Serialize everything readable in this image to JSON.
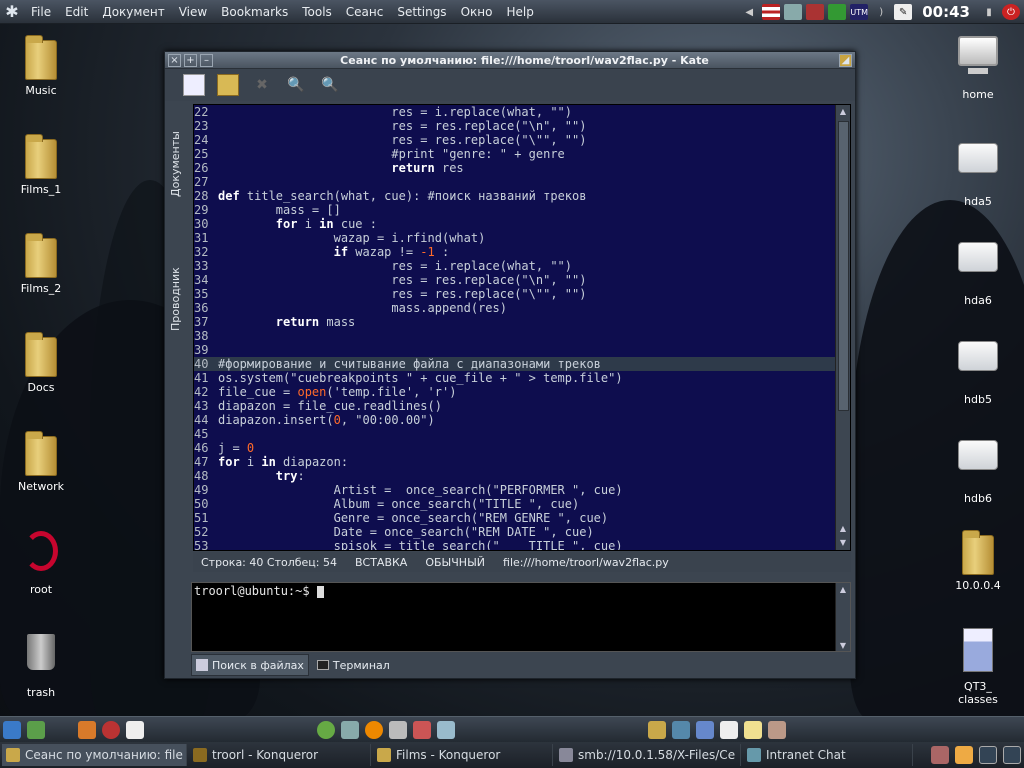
{
  "menubar": {
    "items": [
      "File",
      "Edit",
      "Документ",
      "View",
      "Bookmarks",
      "Tools",
      "Сеанс",
      "Settings",
      "Окно",
      "Help"
    ],
    "clock": "00:43"
  },
  "desktop_left": [
    {
      "label": "Music",
      "icon": "music-folder-icon"
    },
    {
      "label": "Films_1",
      "icon": "films-folder-icon"
    },
    {
      "label": "Films_2",
      "icon": "films-folder-icon"
    },
    {
      "label": "Docs",
      "icon": "docs-folder-icon"
    },
    {
      "label": "Network",
      "icon": "network-folder-icon"
    },
    {
      "label": "root",
      "icon": "debian-swirl-icon"
    },
    {
      "label": "trash",
      "icon": "trash-icon"
    }
  ],
  "desktop_right": [
    {
      "label": "home",
      "icon": "monitor-icon"
    },
    {
      "label": "hda5",
      "icon": "drive-icon"
    },
    {
      "label": "hda6",
      "icon": "drive-icon"
    },
    {
      "label": "hdb5",
      "icon": "drive-icon"
    },
    {
      "label": "hdb6",
      "icon": "drive-icon"
    },
    {
      "label": "10.0.0.4",
      "icon": "network-folder-icon"
    },
    {
      "label": "QT3_\nclasses",
      "icon": "document-icon"
    }
  ],
  "kate": {
    "title": "Сеанс по умолчанию: file:///home/troorl/wav2flac.py - Kate",
    "side_tabs": [
      "Документы",
      "Проводник"
    ],
    "code_lines": [
      [
        "22",
        "\t\t\tres = i.replace(what, \"\")"
      ],
      [
        "23",
        "\t\t\tres = res.replace(\"\\n\", \"\")"
      ],
      [
        "24",
        "\t\t\tres = res.replace(\"\\\"\", \"\")"
      ],
      [
        "25",
        "\t\t\t#print \"genre: \" + genre"
      ],
      [
        "26",
        "\t\t\treturn res"
      ],
      [
        "27",
        ""
      ],
      [
        "28",
        "def title_search(what, cue): #поиск названий треков"
      ],
      [
        "29",
        "\tmass = []"
      ],
      [
        "30",
        "\tfor i in cue :"
      ],
      [
        "31",
        "\t\twazap = i.rfind(what)"
      ],
      [
        "32",
        "\t\tif wazap != -1 :"
      ],
      [
        "33",
        "\t\t\tres = i.replace(what, \"\")"
      ],
      [
        "34",
        "\t\t\tres = res.replace(\"\\n\", \"\")"
      ],
      [
        "35",
        "\t\t\tres = res.replace(\"\\\"\", \"\")"
      ],
      [
        "36",
        "\t\t\tmass.append(res)"
      ],
      [
        "37",
        "\treturn mass"
      ],
      [
        "38",
        ""
      ],
      [
        "39",
        ""
      ],
      [
        "40",
        "#формирование и считывание файла с диапазонами треков"
      ],
      [
        "41",
        "os.system(\"cuebreakpoints \" + cue_file + \" > temp.file\")"
      ],
      [
        "42",
        "file_cue = open('temp.file', 'r')"
      ],
      [
        "43",
        "diapazon = file_cue.readlines()"
      ],
      [
        "44",
        "diapazon.insert(0, \"00:00.00\")"
      ],
      [
        "45",
        ""
      ],
      [
        "46",
        "j = 0"
      ],
      [
        "47",
        "for i in diapazon:"
      ],
      [
        "48",
        "\ttry:"
      ],
      [
        "49",
        "\t\tArtist =  once_search(\"PERFORMER \", cue)"
      ],
      [
        "50",
        "\t\tAlbum = once_search(\"TITLE \", cue)"
      ],
      [
        "51",
        "\t\tGenre = once_search(\"REM GENRE \", cue)"
      ],
      [
        "52",
        "\t\tDate = once_search(\"REM DATE \", cue)"
      ],
      [
        "53",
        "\t\tspisok = title_search(\"    TITLE \", cue)"
      ]
    ],
    "current_line": "40",
    "status": {
      "position": "Строка: 40 Столбец: 54",
      "mode": "ВСТАВКА",
      "select": "ОБЫЧНЫЙ",
      "path": "file:///home/troorl/wav2flac.py"
    },
    "terminal_prompt": "troorl@ubuntu:~$ ",
    "bottom_tabs": [
      "Поиск в файлах",
      "Терминал"
    ]
  },
  "taskbar": [
    {
      "label": "Сеанс по умолчанию: file",
      "active": true
    },
    {
      "label": "troorl - Konqueror",
      "active": false
    },
    {
      "label": "Films - Konqueror",
      "active": false
    },
    {
      "label": "smb://10.0.1.58/X-Files/Ce",
      "active": false
    },
    {
      "label": "Intranet Chat",
      "active": false
    }
  ],
  "colors": {
    "editor_bg": "#0e0d4e",
    "keyword": "#ffffff",
    "comment": "#c8d0da",
    "string": "#c8d0da",
    "builtin_open": "#ff6a2a",
    "number": "#ff6a2a"
  }
}
